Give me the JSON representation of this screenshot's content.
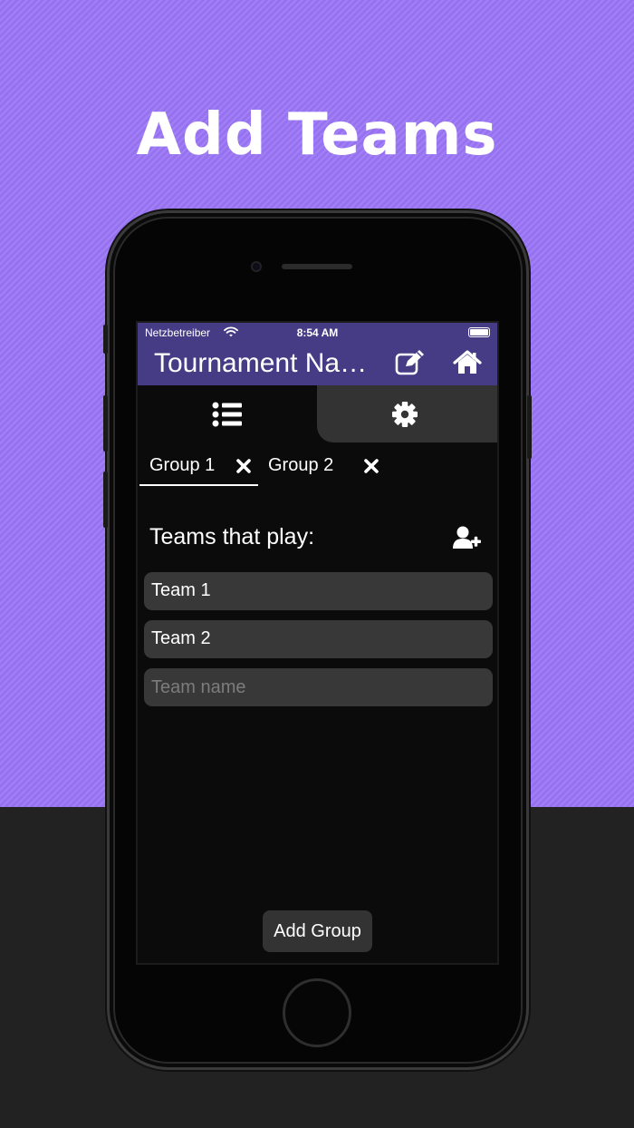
{
  "headline": "Add Teams",
  "status_bar": {
    "carrier": "Netzbetreiber",
    "time": "8:54 AM"
  },
  "nav": {
    "title": "Tournament Na…",
    "icons": [
      "edit-icon",
      "home-icon"
    ]
  },
  "tabs": [
    {
      "icon": "list-icon",
      "selected": true
    },
    {
      "icon": "gear-icon",
      "selected": false
    }
  ],
  "groups": [
    {
      "label": "Group 1",
      "active": true
    },
    {
      "label": "Group 2",
      "active": false
    }
  ],
  "teams_section": {
    "title": "Teams that play:",
    "teams": [
      "Team 1",
      "Team 2"
    ],
    "new_team_placeholder": "Team name"
  },
  "add_group_label": "Add Group",
  "colors": {
    "background_accent": "#9b76f7",
    "nav_bar": "#463c85",
    "field": "#383838"
  }
}
